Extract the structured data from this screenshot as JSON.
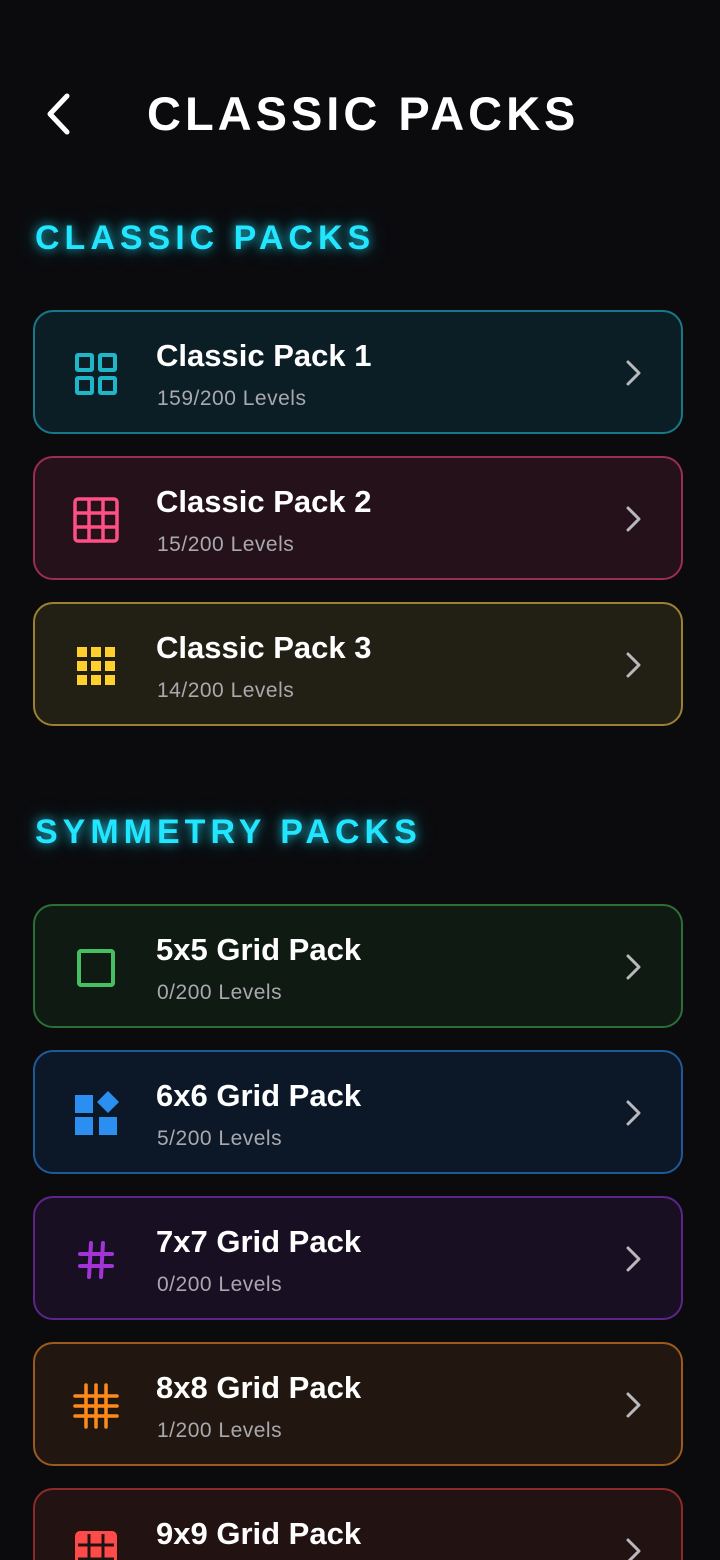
{
  "header": {
    "title": "CLASSIC PACKS",
    "back_icon": "chevron-left-icon"
  },
  "sections": [
    {
      "title": "CLASSIC PACKS",
      "packs": [
        {
          "name": "Classic Pack 1",
          "progress": "159/200 Levels",
          "icon": "grid-2x2-outline-icon",
          "color": "#1fb6c9",
          "bg": "#0b1e26",
          "border": "#18788a"
        },
        {
          "name": "Classic Pack 2",
          "progress": "15/200 Levels",
          "icon": "grid-4x4-icon",
          "color": "#ff4f86",
          "bg": "#241119",
          "border": "#9b2c57"
        },
        {
          "name": "Classic Pack 3",
          "progress": "14/200 Levels",
          "icon": "dots-grid-icon",
          "color": "#ffcf2e",
          "bg": "#221f15",
          "border": "#9c8230"
        }
      ]
    },
    {
      "title": "SYMMETRY PACKS",
      "packs": [
        {
          "name": "5x5 Grid Pack",
          "progress": "0/200 Levels",
          "icon": "square-outline-icon",
          "color": "#44c062",
          "bg": "#0f1a12",
          "border": "#2c6f36"
        },
        {
          "name": "6x6 Grid Pack",
          "progress": "5/200 Levels",
          "icon": "widgets-icon",
          "color": "#2a8ff0",
          "bg": "#0c1828",
          "border": "#1f5a98"
        },
        {
          "name": "7x7 Grid Pack",
          "progress": "0/200 Levels",
          "icon": "hash-icon",
          "color": "#a233d6",
          "bg": "#190f22",
          "border": "#5e2588"
        },
        {
          "name": "8x8 Grid Pack",
          "progress": "1/200 Levels",
          "icon": "dense-hash-icon",
          "color": "#ff8a1a",
          "bg": "#211710",
          "border": "#9c5a1f"
        },
        {
          "name": "9x9 Grid Pack",
          "progress": "",
          "icon": "grid-filled-icon",
          "color": "#ff4a4a",
          "bg": "#231212",
          "border": "#8c2a2a"
        }
      ]
    }
  ]
}
